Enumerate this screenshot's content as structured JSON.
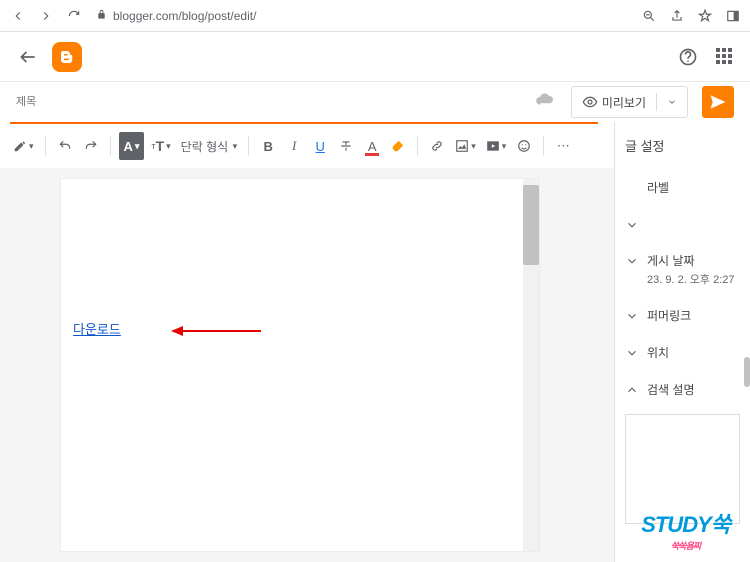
{
  "browser": {
    "url": "blogger.com/blog/post/edit/"
  },
  "header": {
    "logo_letter": "B"
  },
  "title": {
    "placeholder": "제목"
  },
  "actions": {
    "preview_label": "미리보기"
  },
  "toolbar": {
    "paragraph_format": "단락 형식",
    "font_style_icon": "A",
    "font_size_icon": "ᴛT",
    "bold": "B",
    "italic": "I",
    "underline": "U",
    "text_color": "A"
  },
  "editor": {
    "link_text": "다운로드"
  },
  "sidebar": {
    "title": "글 설정",
    "label": "라벨",
    "post_date": "게시 날짜",
    "post_date_value": "23. 9. 2. 오후 2:27",
    "permalink": "퍼머링크",
    "location": "위치",
    "search_desc": "검색 설명"
  },
  "watermark": {
    "main": "STUDY쑥",
    "sub": "쑥쑥욤찌"
  }
}
